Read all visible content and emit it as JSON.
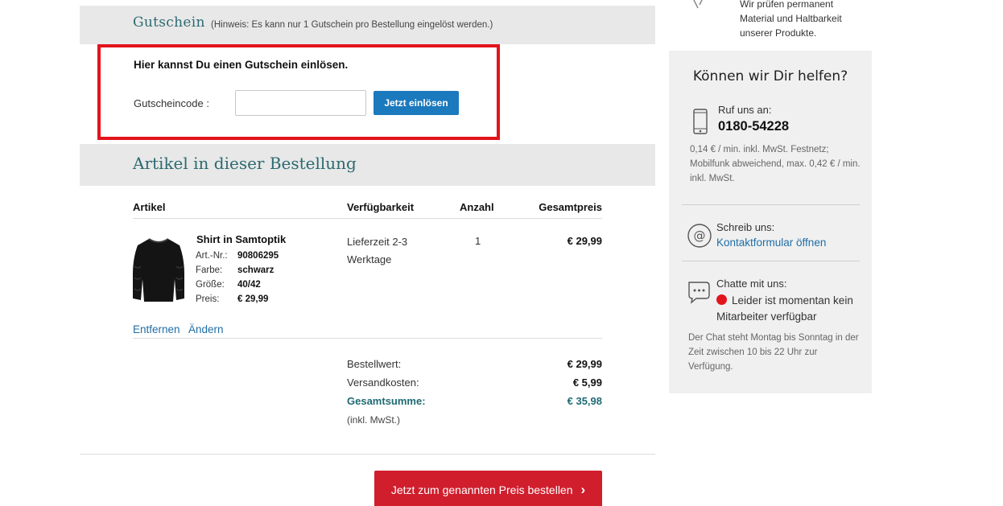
{
  "voucher": {
    "section_title": "Gutschein",
    "hint": "(Hinweis: Es kann nur 1 Gutschein pro Bestellung eingelöst werden.)",
    "heading": "Hier kannst Du einen Gutschein einlösen.",
    "code_label": "Gutscheincode :",
    "code_value": "",
    "redeem_button": "Jetzt einlösen"
  },
  "order": {
    "section_title": "Artikel in dieser Bestellung",
    "columns": [
      "Artikel",
      "Verfügbarkeit",
      "Anzahl",
      "Gesamtpreis"
    ],
    "item": {
      "name": "Shirt in Samtoptik",
      "attributes": [
        {
          "label": "Art.-Nr.:",
          "value": "90806295"
        },
        {
          "label": "Farbe:",
          "value": "schwarz"
        },
        {
          "label": "Größe:",
          "value": "40/42"
        },
        {
          "label": "Preis:",
          "value": "€ 29,99"
        }
      ],
      "availability": "Lieferzeit 2-3 Werktage",
      "quantity": "1",
      "total": "€ 29,99",
      "remove_link": "Entfernen",
      "edit_link": "Ändern"
    },
    "summary": {
      "subtotal_label": "Bestellwert:",
      "subtotal_value": "€ 29,99",
      "shipping_label": "Versandkosten:",
      "shipping_value": "€ 5,99",
      "total_label": "Gesamtsumme:",
      "total_value": "€ 35,98",
      "tax_note": "(inkl. MwSt.)"
    },
    "order_button": "Jetzt zum genannten Preis bestellen",
    "order_button_chevron": "›"
  },
  "sidebar": {
    "top_text": [
      "Wir prüfen permanent",
      "Material und Haltbarkeit",
      "unserer Produkte."
    ],
    "help_title": "Können wir Dir helfen?",
    "call_label": "Ruf uns an:",
    "phone": "0180-54228",
    "tariff": "0,14 € / min. inkl. MwSt. Festnetz; Mobilfunk abweichend, max. 0,42 € / min. inkl. MwSt.",
    "write_label": "Schreib uns:",
    "contact_link": "Kontaktformular öffnen",
    "chat_label": "Chatte mit uns:",
    "chat_status": "Leider ist momentan kein Mitarbeiter verfügbar",
    "chat_hours": "Der Chat steht Montag bis Sonntag in der Zeit zwischen 10 bis 22 Uhr zur Verfügung."
  },
  "colors": {
    "accent_teal": "#2d6a71",
    "highlight_red": "#e3141b",
    "primary_blue": "#1b79bd",
    "order_red": "#d01e2d",
    "link_blue": "#1f6ea5"
  }
}
